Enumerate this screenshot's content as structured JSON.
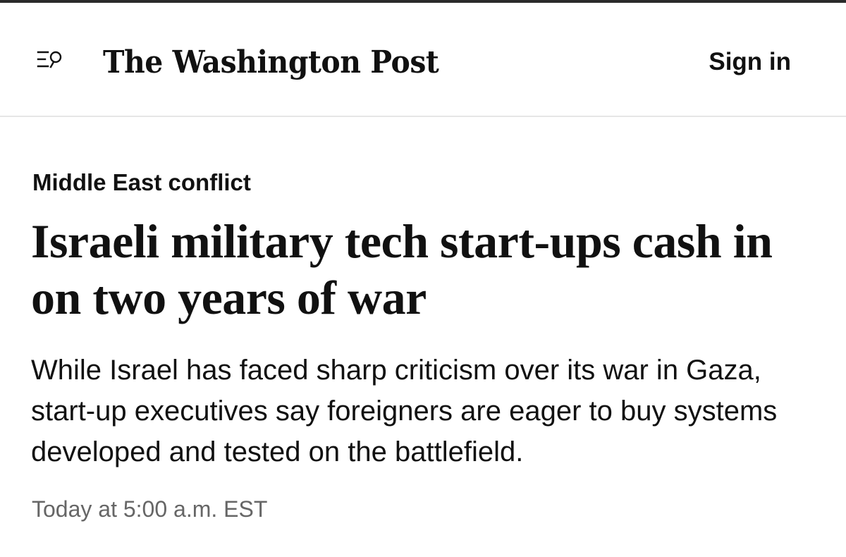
{
  "header": {
    "menu_icon": "menu-search-icon",
    "logo_text": "The Washington Post",
    "sign_in_label": "Sign in"
  },
  "article": {
    "kicker": "Middle East conflict",
    "headline": "Israeli military tech start-ups cash in on two years of war",
    "dek": "While Israel has faced sharp criticism over its war in Gaza, start-up executives say foreigners are eager to buy systems developed and tested on the battlefield.",
    "timestamp": "Today at 5:00 a.m. EST"
  },
  "colors": {
    "text": "#111111",
    "timestamp": "#666666",
    "divider": "#e6e6e6",
    "top_rule": "#2a2a2a"
  }
}
